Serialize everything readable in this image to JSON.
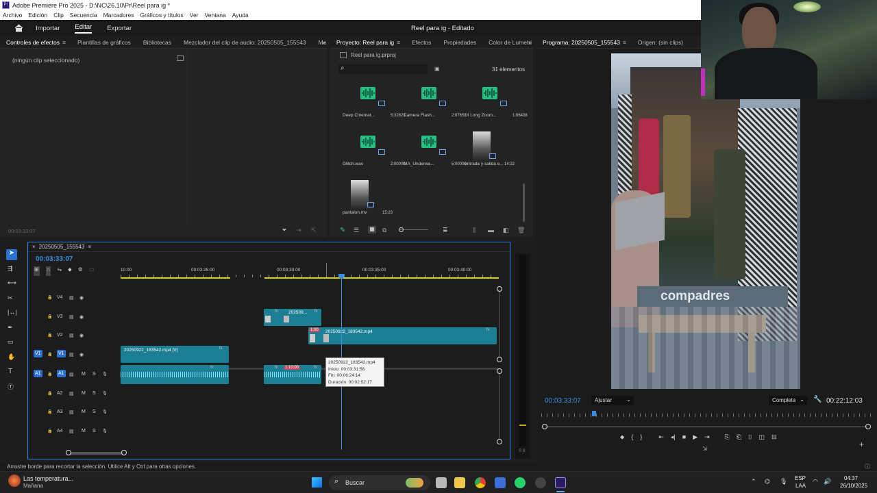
{
  "window": {
    "title": "Adobe Premiere Pro 2025 - D:\\NC\\26.10\\Pr\\Reel para ig *",
    "logo": "Pr"
  },
  "menu": [
    "Archivo",
    "Edición",
    "Clip",
    "Secuencia",
    "Marcadores",
    "Gráficos y títulos",
    "Ver",
    "Ventana",
    "Ayuda"
  ],
  "header": {
    "home_icon": "home-icon",
    "nav": [
      "Importar",
      "Editar",
      "Exportar"
    ],
    "active": "Editar",
    "project_title": "Reel para ig - Editado"
  },
  "effects_panel": {
    "tabs": [
      "Controles de efectos",
      "Plantillas de gráficos",
      "Bibliotecas",
      "Mezclador del clip de audio: 20250505_155543",
      "Mezclad"
    ],
    "no_clip": "(ningún clip seleccionado)",
    "timecode": "00:03:33:07"
  },
  "project_panel": {
    "tabs": [
      "Proyecto: Reel para ig",
      "Efectos",
      "Propiedades",
      "Color de Lumetri"
    ],
    "file": "Reel para ig.prproj",
    "count": "31 elementos",
    "items": [
      {
        "name": "Deep Cinemat...",
        "duration": "5:32823",
        "type": "audio"
      },
      {
        "name": "Camera Flash...",
        "duration": "2:07652",
        "type": "audio"
      },
      {
        "name": "UI Long Zoom...",
        "duration": "1:06438",
        "type": "audio"
      },
      {
        "name": "Glitch.wav",
        "duration": "2:00000",
        "type": "audio"
      },
      {
        "name": "MA_Underwa...",
        "duration": "5:00000",
        "type": "audio"
      },
      {
        "name": "entrada y salida e...",
        "duration": "14:22",
        "type": "video"
      },
      {
        "name": "pantalon.mv",
        "duration": "15:23",
        "type": "video"
      }
    ]
  },
  "program_panel": {
    "tabs": [
      "Programa: 20250505_155543",
      "Origen: (sin clips)"
    ],
    "timecode": "00:03:33:07",
    "fit": "Ajustar",
    "quality": "Completa",
    "duration": "00:22:12:03",
    "store_text": "compadres"
  },
  "timeline": {
    "sequence": "20250505_155543",
    "timecode": "00:03:33:07",
    "ruler": [
      "10:00",
      "00:03:25:00",
      "00:03:30:00",
      "00:03:35:00",
      "00:03:40:00"
    ],
    "tracks": [
      {
        "id": "V4",
        "type": "video"
      },
      {
        "id": "V3",
        "type": "video"
      },
      {
        "id": "V2",
        "type": "video"
      },
      {
        "id": "V1",
        "type": "video",
        "src": "V1"
      },
      {
        "id": "A1",
        "type": "audio",
        "src": "A1"
      },
      {
        "id": "A2",
        "type": "audio"
      },
      {
        "id": "A3",
        "type": "audio"
      },
      {
        "id": "A4",
        "type": "audio"
      }
    ],
    "track_buttons": {
      "mute": "M",
      "solo": "S"
    },
    "clips": {
      "v3": "202509...",
      "v2": "20250922_183542.mp4",
      "v1": "20250922_183542.mp4 [V]",
      "v2_label": "1:00",
      "a1_label": "1:10:00"
    },
    "tooltip": {
      "name": "20250922_183542.mp4",
      "start": "Inicio: 00:03:31:58",
      "end": "Fin: 00:06:24:14",
      "duration": "Duración: 00:02:52:17"
    },
    "meter_label": "S S"
  },
  "status_bar": "Arrastre borde para recortar la selección. Utilice Alt y Ctrl para otras opciones.",
  "taskbar": {
    "weather_title": "Las temperatura...",
    "weather_sub": "Mañana",
    "search": "Buscar",
    "lang": "ESP",
    "lang_sub": "LAA",
    "time": "04:37",
    "date": "26/10/2025"
  },
  "colors": {
    "accent": "#2d8ceb",
    "clip_teal": "#1d7f93",
    "audio_green": "#26c085",
    "playhead": "#3a8dde",
    "work_area": "#d7d400"
  }
}
